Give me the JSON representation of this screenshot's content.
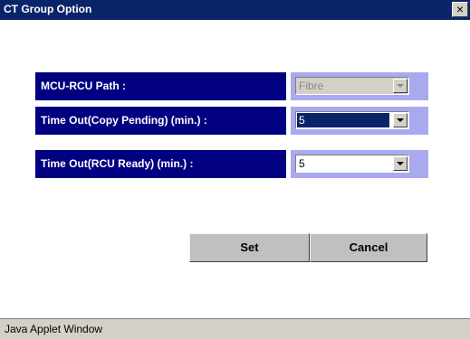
{
  "window": {
    "title": "CT Group Option",
    "close_glyph": "×",
    "status_text": "Java Applet Window"
  },
  "form": {
    "rows": [
      {
        "label": "MCU-RCU Path :",
        "value": "Fibre",
        "state": "disabled"
      },
      {
        "label": "Time Out(Copy Pending) (min.) :",
        "value": "5",
        "state": "focused"
      },
      {
        "label": "Time Out(RCU Ready) (min.) :",
        "value": "5",
        "state": "normal"
      }
    ]
  },
  "buttons": {
    "set_label": "Set",
    "cancel_label": "Cancel"
  },
  "colors": {
    "titlebar": "#0a246a",
    "label_bg": "#000080",
    "field_bg": "#a9a9ef",
    "button_bg": "#c0c0c0"
  },
  "icons": [
    "close-icon",
    "chevron-down-icon"
  ]
}
